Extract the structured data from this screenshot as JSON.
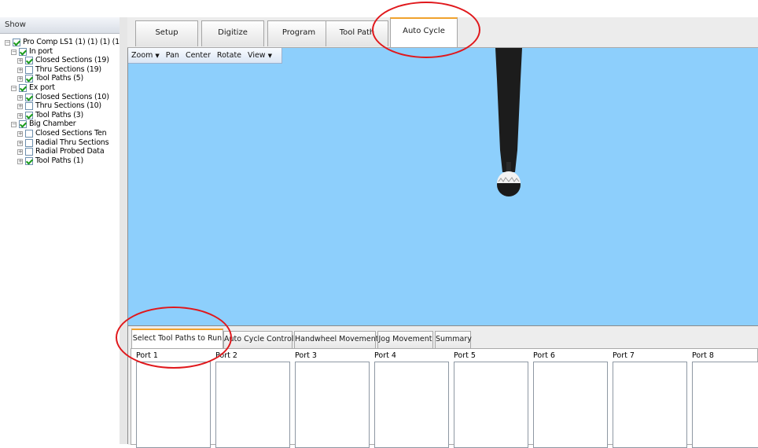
{
  "tree": {
    "header": "Show",
    "nodes": [
      {
        "label": "Pro Comp LS1 (1) (1) (1) (1",
        "checked": true,
        "expander": "−"
      },
      {
        "label": "In port",
        "checked": true,
        "expander": "−"
      },
      {
        "label": "Closed Sections (19)",
        "checked": true,
        "expander": "+"
      },
      {
        "label": "Thru Sections (19)",
        "checked": false,
        "expander": "+"
      },
      {
        "label": "Tool Paths (5)",
        "checked": true,
        "expander": "+"
      },
      {
        "label": "Ex port",
        "checked": true,
        "expander": "−"
      },
      {
        "label": "Closed Sections (10)",
        "checked": true,
        "expander": "+"
      },
      {
        "label": "Thru Sections (10)",
        "checked": false,
        "expander": "+"
      },
      {
        "label": "Tool Paths (3)",
        "checked": true,
        "expander": "+"
      },
      {
        "label": "Big Chamber",
        "checked": true,
        "expander": "−"
      },
      {
        "label": "Closed Sections Ten",
        "checked": false,
        "expander": "+"
      },
      {
        "label": "Radial Thru Sections",
        "checked": false,
        "expander": "+"
      },
      {
        "label": "Radial Probed Data",
        "checked": false,
        "expander": "+"
      },
      {
        "label": "Tool Paths (1)",
        "checked": true,
        "expander": "+"
      }
    ]
  },
  "main_tabs": [
    "Setup",
    "Digitize",
    "Program",
    "Tool Path",
    "Auto Cycle"
  ],
  "active_main_tab": "Auto Cycle",
  "view_toolbar": {
    "zoom": "Zoom",
    "pan": "Pan",
    "center": "Center",
    "rotate": "Rotate",
    "view": "View"
  },
  "bottom_tabs": [
    "Select Tool Paths to Run",
    "Auto Cycle Controls",
    "Handwheel Movement",
    "Jog Movement",
    "Summary"
  ],
  "active_bottom_tab": "Select Tool Paths to Run",
  "ports": [
    "Port 1",
    "Port 2",
    "Port 3",
    "Port 4",
    "Port 5",
    "Port 6",
    "Port 7",
    "Port 8"
  ],
  "colors": {
    "viewport_bg": "#8dcffc",
    "active_tab_accent": "#f0a22d",
    "annotation_ring": "#e0181c",
    "probe": "#1c1c1c"
  }
}
